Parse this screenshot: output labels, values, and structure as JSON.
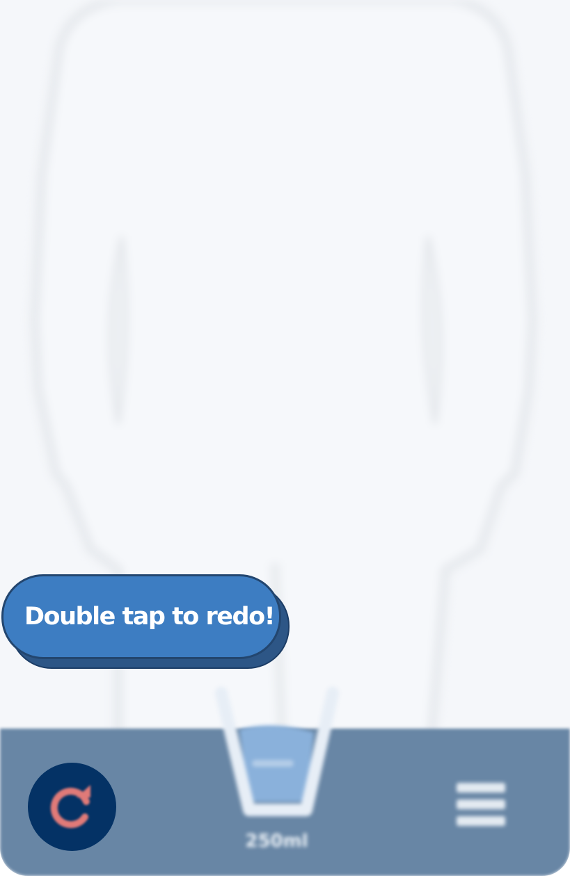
{
  "tooltip": {
    "text": "Double tap to redo!"
  },
  "glass": {
    "amount_label": "250ml",
    "fill_level": 0.75
  },
  "icons": {
    "redo": "redo-icon",
    "glass": "water-glass-icon",
    "menu": "menu-grid-icon"
  },
  "colors": {
    "background": "#f5f7fa",
    "bottom_bar": "#6886a5",
    "redo_button_bg": "#043265",
    "redo_arrow": "#e07a78",
    "tooltip_bg": "#3d7dc2",
    "tooltip_shadow": "#2d5686",
    "water": "#8ab1db"
  }
}
